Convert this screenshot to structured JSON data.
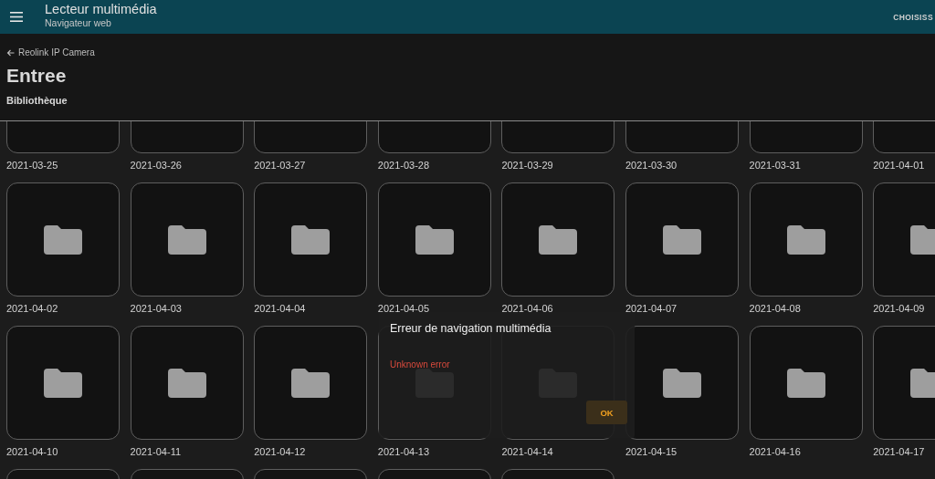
{
  "app_bar": {
    "title": "Lecteur multimédia",
    "subtitle": "Navigateur web",
    "action": "CHOISISS"
  },
  "browser_header": {
    "back_label": "Reolink IP Camera",
    "title": "Entree",
    "section": "Bibliothèque"
  },
  "folders": [
    {
      "label": "2021-03-25"
    },
    {
      "label": "2021-03-26"
    },
    {
      "label": "2021-03-27"
    },
    {
      "label": "2021-03-28"
    },
    {
      "label": "2021-03-29"
    },
    {
      "label": "2021-03-30"
    },
    {
      "label": "2021-03-31"
    },
    {
      "label": "2021-04-01"
    },
    {
      "label": "2021-04-02"
    },
    {
      "label": "2021-04-03"
    },
    {
      "label": "2021-04-04"
    },
    {
      "label": "2021-04-05"
    },
    {
      "label": "2021-04-06"
    },
    {
      "label": "2021-04-07"
    },
    {
      "label": "2021-04-08"
    },
    {
      "label": "2021-04-09"
    },
    {
      "label": "2021-04-10"
    },
    {
      "label": "2021-04-11"
    },
    {
      "label": "2021-04-12"
    },
    {
      "label": "2021-04-13"
    },
    {
      "label": "2021-04-14"
    },
    {
      "label": "2021-04-15"
    },
    {
      "label": "2021-04-16"
    },
    {
      "label": "2021-04-17"
    },
    {
      "kind": "pending"
    },
    {
      "kind": "pending"
    },
    {
      "kind": "pending"
    },
    {
      "kind": "pending"
    },
    {
      "kind": "pending"
    }
  ],
  "dialog": {
    "title": "Erreur de navigation multimédia",
    "message": "Unknown error",
    "button": "OK"
  }
}
